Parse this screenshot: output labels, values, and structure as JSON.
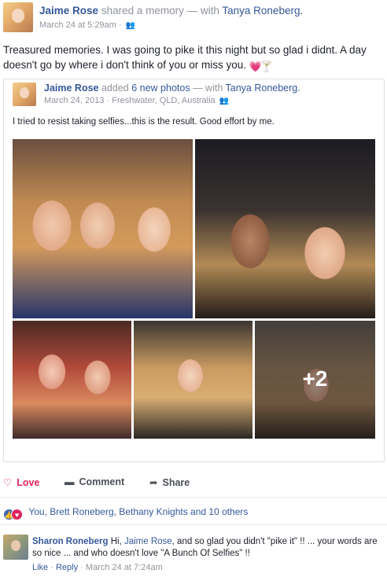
{
  "post": {
    "author": "Jaime Rose",
    "action_text": "shared a memory — with",
    "tagged": "Tanya Roneberg.",
    "timestamp": "March 24 at 5:29am",
    "sep": "·",
    "status_text": "Treasured memories. I was going to pike it this night but so glad i didnt. A day doesn't go by where i don't think of you or miss you.",
    "emoji1": "💗",
    "emoji2": "🍸",
    "friends_icon": "👥"
  },
  "shared": {
    "author": "Jaime Rose",
    "added": "added",
    "photos_link": "6 new photos",
    "with": "— with",
    "tagged": "Tanya Roneberg.",
    "date": "March 24, 2013",
    "sep": "·",
    "location": "Freshwater, QLD, Australia",
    "caption": "I tried to resist taking selfies...this is the result. Good effort by me.",
    "more_count": "+2"
  },
  "actions": {
    "love_icon": "♡",
    "love": "Love",
    "comment_icon": "▬",
    "comment": "Comment",
    "share_icon": "➦",
    "share": "Share"
  },
  "reactions": {
    "like_icon": "👍",
    "love_icon": "♥",
    "names": "You, Brett Roneberg, Bethany Knights and 10 others"
  },
  "comment": {
    "author": "Sharon Roneberg",
    "text_before": "Hi,",
    "mention": "Jaime Rose",
    "text_after": ", and so glad you didn't \"pike it\" !! ... your words are so nice ... and who doesn't love \"A Bunch Of Selfies\" !!",
    "like": "Like",
    "dot": "·",
    "reply": "Reply",
    "time": "March 24 at 7:24am"
  }
}
